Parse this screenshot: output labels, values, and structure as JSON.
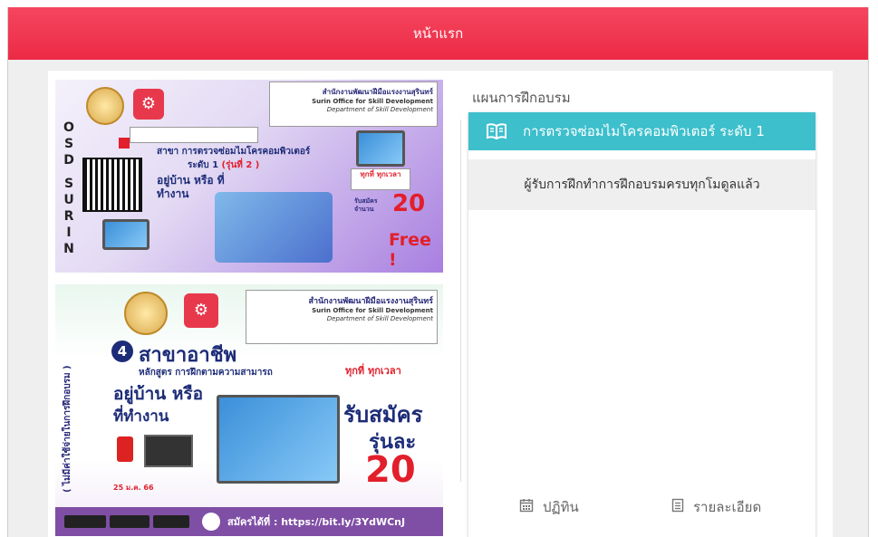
{
  "header": {
    "title": "หน้าแรก"
  },
  "plan": {
    "section_title": "แผนการฝึกอบรม",
    "course_title": "การตรวจซ่อมไมโครคอมพิวเตอร์ ระดับ 1",
    "message": "ผู้รับการฝึกทำการฝึกอบรมครบทุกโมดูลแล้ว",
    "calendar_label": "ปฏิทิน",
    "details_label": "รายละเอียด"
  },
  "poster_top": {
    "org_th": "สำนักงานพัฒนาฝีมือแรงงานสุรินทร์",
    "org_en": "Surin Office for Skill Development",
    "dept_en": "Department of Skill Development",
    "side_letters": [
      "O",
      "S",
      "D",
      "S",
      "U",
      "R",
      "I",
      "N"
    ],
    "course_line1": "สาขา การตรวจซ่อมไมโครคอมพิวเตอร์",
    "course_line2": "ระดับ 1",
    "course_gen": "(รุ่นที่ 2 )",
    "home_work": "อยู่บ้าน หรือ ที่ทำงาน",
    "anytime": "ทุกที่ ทุกเวลา",
    "seats_label": "รับสมัคร จำนวน",
    "seats": "20",
    "free": "Free !"
  },
  "poster_bottom": {
    "org_th": "สำนักงานพัฒนาฝีมือแรงงานสุรินทร์",
    "org_en": "Surin Office for Skill Development",
    "dept_en": "Department of Skill Development",
    "num": "4",
    "headline": "สาขาอาชีพ",
    "subline": "หลักสูตร การฝึกตามความสามารถ",
    "anytime": "ทุกที่ ทุกเวลา",
    "home": "อยู่บ้าน หรือ",
    "work": "ที่ทำงาน",
    "apply": "รับสมัคร",
    "per_gen": "รุ่นละ",
    "seats": "20",
    "vertical": "( ไม่มีค่าใช้จ่ายในการฝึกอบรม )",
    "date": "25 ม.ค. 66",
    "apply_link": "สมัครได้ที่ : https://bit.ly/3YdWCnJ"
  }
}
